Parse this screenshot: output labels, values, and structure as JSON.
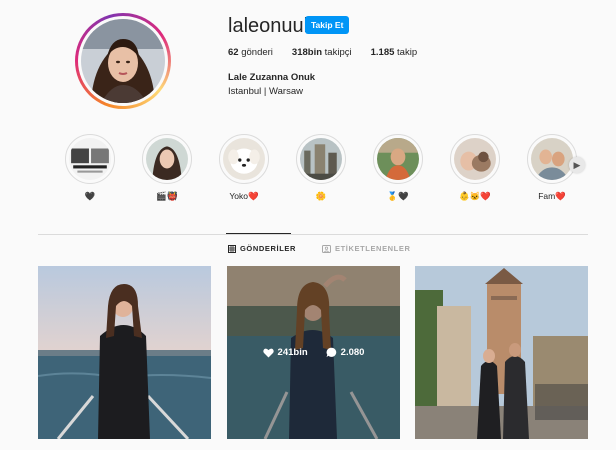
{
  "profile": {
    "username": "laleonuuk",
    "follow_label": "Takip Et",
    "posts_count": "62",
    "posts_label": "gönderi",
    "followers_count": "318bin",
    "followers_label": "takipçi",
    "following_count": "1.185",
    "following_label": "takip",
    "full_name": "Lale Zuzanna Onuk",
    "bio": "Istanbul | Warsaw"
  },
  "highlights": [
    {
      "label": "🖤",
      "icon": "photo-collage"
    },
    {
      "label": "🎬👹",
      "icon": "portrait"
    },
    {
      "label": "Yoko❤️",
      "icon": "dog"
    },
    {
      "label": "🌼",
      "icon": "city"
    },
    {
      "label": "🥇🖤",
      "icon": "friend"
    },
    {
      "label": "👶🐱❤️",
      "icon": "pets"
    },
    {
      "label": "Fam❤️",
      "icon": "family"
    }
  ],
  "tabs": [
    {
      "label": "GÖNDERİLER",
      "active": true
    },
    {
      "label": "ETİKETLENENLER",
      "active": false
    }
  ],
  "hover_post": {
    "likes": "241bin",
    "comments": "2.080"
  },
  "colors": {
    "accent": "#0095f6",
    "text": "#262626",
    "muted": "#8e8e8e",
    "border": "#dbdbdb"
  }
}
